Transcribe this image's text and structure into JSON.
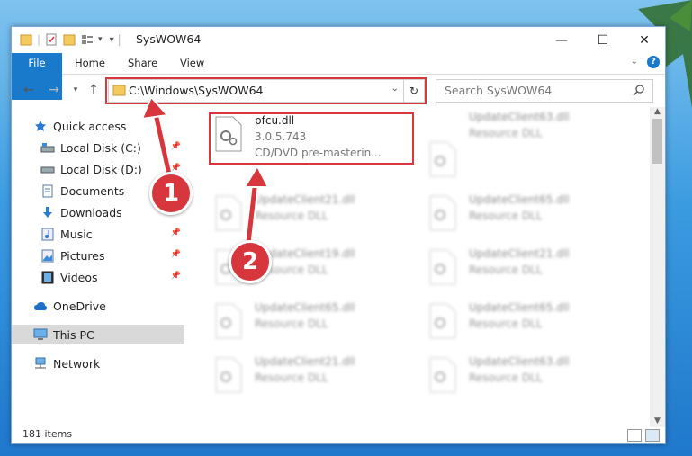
{
  "window": {
    "title": "SysWOW64",
    "controls": {
      "minimize": "—",
      "maximize": "☐",
      "close": "✕"
    }
  },
  "ribbon": {
    "tabs": [
      "File",
      "Home",
      "Share",
      "View"
    ]
  },
  "address": {
    "path": "C:\\Windows\\SysWOW64",
    "search_placeholder": "Search SysWOW64"
  },
  "sidebar": {
    "items": [
      {
        "label": "Quick access",
        "icon": "star-icon"
      },
      {
        "label": "Local Disk (C:)",
        "icon": "drive-icon",
        "pinned": true
      },
      {
        "label": "Local Disk (D:)",
        "icon": "drive-icon",
        "pinned": true
      },
      {
        "label": "Documents",
        "icon": "documents-icon",
        "pinned": true
      },
      {
        "label": "Downloads",
        "icon": "download-icon",
        "pinned": true
      },
      {
        "label": "Music",
        "icon": "music-icon",
        "pinned": true
      },
      {
        "label": "Pictures",
        "icon": "pictures-icon",
        "pinned": true
      },
      {
        "label": "Videos",
        "icon": "videos-icon",
        "pinned": true
      },
      {
        "label": "OneDrive",
        "icon": "cloud-icon"
      },
      {
        "label": "This PC",
        "icon": "computer-icon",
        "selected": true
      },
      {
        "label": "Network",
        "icon": "network-icon"
      }
    ]
  },
  "files": {
    "highlighted": {
      "name": "pfcu.dll",
      "version": "3.0.5.743",
      "description": "CD/DVD pre-masterin..."
    },
    "left_column": [
      {
        "name": "UpdateClient21.dll",
        "type": "Resource DLL"
      },
      {
        "name": "UpdateClient19.dll",
        "type": "Resource DLL"
      },
      {
        "name": "UpdateClient65.dll",
        "type": "Resource DLL"
      },
      {
        "name": "UpdateClient21.dll",
        "type": "Resource DLL"
      }
    ],
    "right_column": [
      {
        "name": "UpdateClient63.dll",
        "type": "Resource DLL"
      },
      {
        "name": "UpdateClient65.dll",
        "type": "Resource DLL"
      },
      {
        "name": "UpdateClient21.dll",
        "type": "Resource DLL"
      },
      {
        "name": "UpdateClient65.dll",
        "type": "Resource DLL"
      },
      {
        "name": "UpdateClient63.dll",
        "type": "Resource DLL"
      }
    ]
  },
  "status": {
    "item_count": "181 items"
  },
  "callouts": [
    "1",
    "2"
  ],
  "colors": {
    "accent": "#1979ca",
    "highlight": "#d9363e"
  }
}
